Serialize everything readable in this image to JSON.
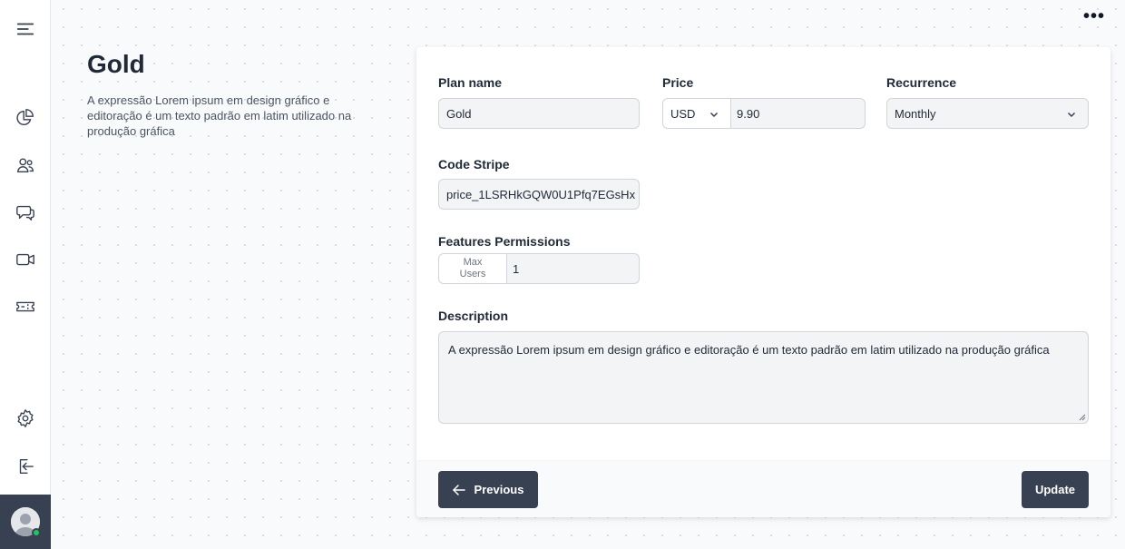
{
  "sidebar": {
    "items": [
      {
        "name": "menu",
        "icon": "menu-icon"
      },
      {
        "name": "dashboard",
        "icon": "pie-chart-icon"
      },
      {
        "name": "users",
        "icon": "users-icon"
      },
      {
        "name": "messages",
        "icon": "chat-bubbles-icon"
      },
      {
        "name": "video",
        "icon": "video-camera-icon"
      },
      {
        "name": "tickets",
        "icon": "ticket-icon"
      },
      {
        "name": "settings",
        "icon": "gear-icon"
      },
      {
        "name": "logout",
        "icon": "logout-icon"
      }
    ],
    "avatar_status_color": "#22c55e"
  },
  "header": {
    "more_label": "•••"
  },
  "info": {
    "title": "Gold",
    "description": "A expressão Lorem ipsum em design gráfico e editoração é um texto padrão em latim utilizado na produção gráfica"
  },
  "form": {
    "plan_name": {
      "label": "Plan name",
      "value": "Gold"
    },
    "price": {
      "label": "Price",
      "currency": "USD",
      "value": "9.90"
    },
    "recurrence": {
      "label": "Recurrence",
      "value": "Monthly"
    },
    "code_stripe": {
      "label": "Code Stripe",
      "value": "price_1LSRHkGQW0U1Pfq7EGsHx"
    },
    "features": {
      "label": "Features Permissions",
      "addon_line1": "Max",
      "addon_line2": "Users",
      "value": "1"
    },
    "description": {
      "label": "Description",
      "value": "A expressão Lorem ipsum em design gráfico e editoração é um texto padrão em latim utilizado na produção gráfica"
    }
  },
  "footer": {
    "previous_label": "Previous",
    "update_label": "Update"
  },
  "colors": {
    "button_bg": "#374151",
    "card_bg": "#ffffff",
    "input_bg": "#f3f4f6"
  }
}
